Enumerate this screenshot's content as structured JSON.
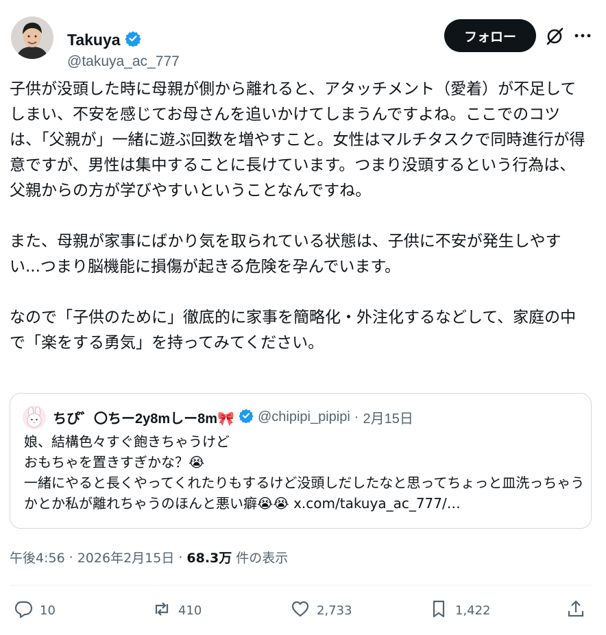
{
  "author": {
    "name": "Takuya",
    "handle": "@takuya_ac_777",
    "verified": true
  },
  "follow_label": "フォロー",
  "tweet_text": "子供が没頭した時に母親が側から離れると、アタッチメント（愛着）が不足してしまい、不安を感じてお母さんを追いかけてしまうんですよね。ここでのコツは、「父親が」一緒に遊ぶ回数を増やすこと。女性はマルチタスクで同時進行が得意ですが、男性は集中することに長けています。つまり没頭するという行為は、父親からの方が学びやすいということなんですね。\n\nまた、母親が家事にばかり気を取られている状態は、子供に不安が発生しやすい...つまり脳機能に損傷が起きる危険を孕んでいます。\n\nなので「子供のために」徹底的に家事を簡略化・外注化するなどして、家庭の中で「楽をする勇気」を持ってみてください。",
  "quote": {
    "name": "ちぴ゛〇ちー2y8mしー8m🎀",
    "handle": "@chipipi_pipipi",
    "date": "2月15日",
    "separator": "·",
    "text": "娘、結構色々すぐ飽きちゃうけど\nおもちゃを置きすぎかな？😭\n一緒にやると長くやってくれたりもするけど没頭しだしたなと思ってちょっと皿洗っちゃうかとか私が離れちゃうのほんと悪い癖😭😭 x.com/takuya_ac_777/…"
  },
  "meta": {
    "time": "午後4:56",
    "sep1": "·",
    "date": "2026年2月15日",
    "sep2": "·",
    "views": "68.3万",
    "views_label": "件の表示"
  },
  "actions": {
    "replies": "10",
    "reposts": "410",
    "likes": "2,733",
    "bookmarks": "1,422"
  },
  "colors": {
    "text": "#0f1419",
    "secondary": "#536471",
    "verified": "#1d9bf0",
    "border": "#cfd9de"
  }
}
